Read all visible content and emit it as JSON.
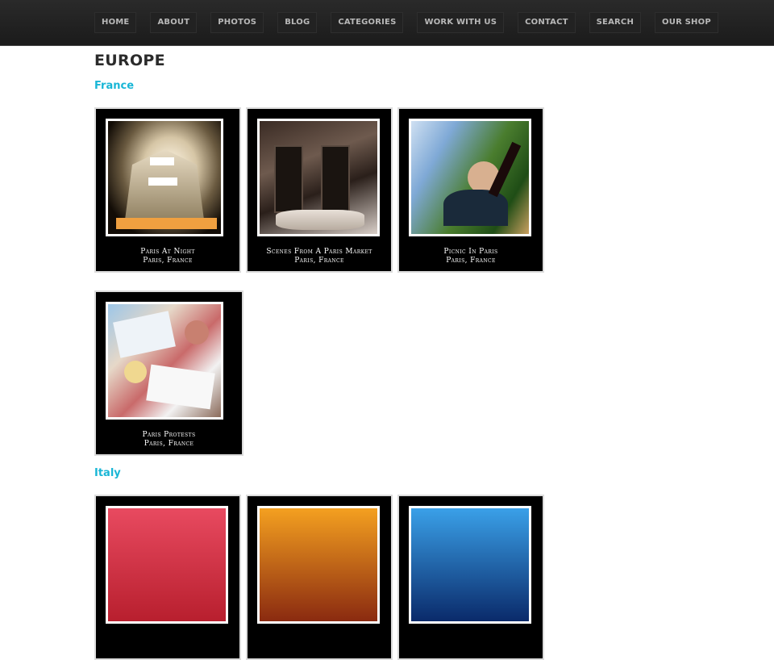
{
  "nav": {
    "items": [
      {
        "label": "HOME"
      },
      {
        "label": "ABOUT"
      },
      {
        "label": "PHOTOS"
      },
      {
        "label": "BLOG"
      },
      {
        "label": "CATEGORIES"
      },
      {
        "label": "WORK WITH US"
      },
      {
        "label": "CONTACT"
      },
      {
        "label": "SEARCH"
      },
      {
        "label": "OUR SHOP"
      }
    ]
  },
  "page": {
    "title": "EUROPE"
  },
  "sections": [
    {
      "title": "France",
      "cards": [
        {
          "title": "Paris At Night",
          "location": "Paris, France"
        },
        {
          "title": "Scenes From A Paris Market",
          "location": "Paris, France"
        },
        {
          "title": "Picnic In Paris",
          "location": "Paris, France"
        },
        {
          "title": "Paris Protests",
          "location": "Paris, France"
        }
      ]
    },
    {
      "title": "Italy",
      "cards": []
    }
  ]
}
